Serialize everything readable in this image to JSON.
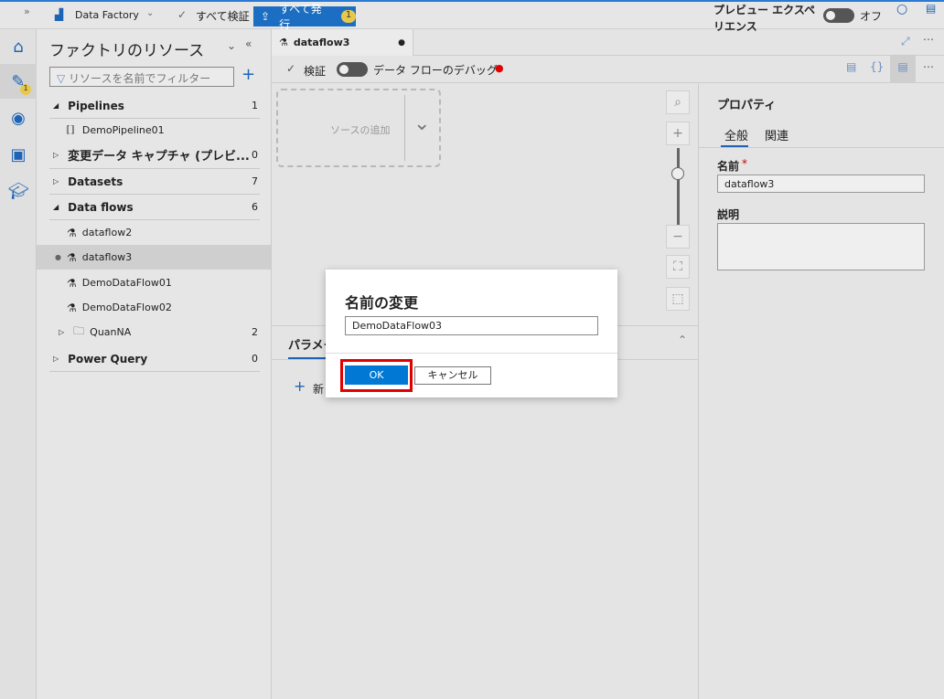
{
  "topbar": {
    "factory": "Data Factory",
    "validate_all": "すべて検証",
    "publish_all": "すべて発行",
    "publish_count": "1",
    "preview_line1": "プレビュー エクスペ",
    "preview_line2": "リエンス",
    "preview_state": "オフ"
  },
  "rail": {
    "author_badge": "1"
  },
  "sidebar": {
    "title": "ファクトリのリソース",
    "filter_placeholder": "リソースを名前でフィルター",
    "sections": [
      {
        "label": "Pipelines",
        "count": "1"
      },
      {
        "label": "変更データ キャプチャ (プレビ...",
        "count": "0"
      },
      {
        "label": "Datasets",
        "count": "7"
      },
      {
        "label": "Data flows",
        "count": "6"
      },
      {
        "label": "Power Query",
        "count": "0"
      }
    ],
    "pipelines": [
      "DemoPipeline01"
    ],
    "dataflows": [
      "dataflow2",
      "dataflow3",
      "DemoDataFlow01",
      "DemoDataFlow02"
    ],
    "folder": {
      "label": "QuanNA",
      "count": "2"
    }
  },
  "editor": {
    "tab": "dataflow3",
    "validate": "検証",
    "debug": "データ フローのデバッグ",
    "add_source": "ソースの追加",
    "params_tab": "パラメー",
    "new_label": "新"
  },
  "properties": {
    "title": "プロパティ",
    "tabs": [
      "全般",
      "関連"
    ],
    "name_label": "名前",
    "required": "*",
    "name_value": "dataflow3",
    "desc_label": "説明"
  },
  "dialog": {
    "title": "名前の変更",
    "value": "DemoDataFlow03",
    "ok": "OK",
    "cancel": "キャンセル"
  },
  "colors": {
    "accent": "#0078d4",
    "highlight": "#e00000",
    "debug_dot": "#e00000"
  }
}
